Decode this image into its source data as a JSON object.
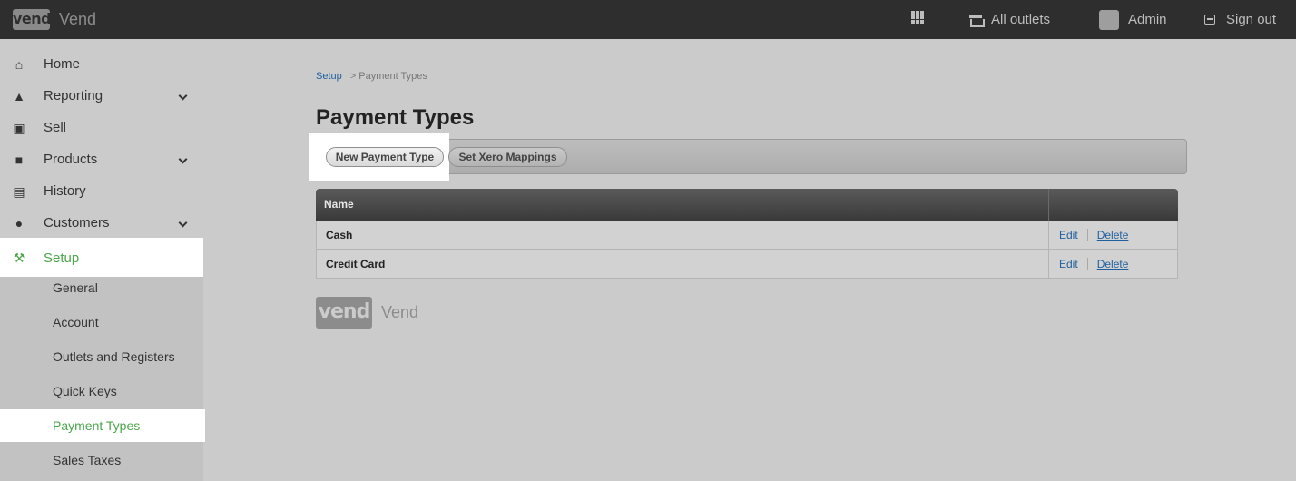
{
  "topbar": {
    "logo_mark": "vend",
    "app_name": "Vend",
    "outlets_label": "All outlets",
    "user_label": "Admin",
    "signout_label": "Sign out"
  },
  "sidebar": {
    "items": [
      {
        "label": "Home",
        "icon": "home-icon",
        "expandable": false
      },
      {
        "label": "Reporting",
        "icon": "chart-icon",
        "expandable": true
      },
      {
        "label": "Sell",
        "icon": "cart-icon",
        "expandable": false
      },
      {
        "label": "Products",
        "icon": "box-icon",
        "expandable": true
      },
      {
        "label": "History",
        "icon": "history-icon",
        "expandable": false
      },
      {
        "label": "Customers",
        "icon": "customers-icon",
        "expandable": true
      },
      {
        "label": "Setup",
        "icon": "wrench-icon",
        "expandable": false,
        "active": true
      }
    ],
    "setup_subitems": [
      {
        "label": "General"
      },
      {
        "label": "Account"
      },
      {
        "label": "Outlets and Registers"
      },
      {
        "label": "Quick Keys"
      },
      {
        "label": "Payment Types",
        "active": true
      },
      {
        "label": "Sales Taxes"
      }
    ]
  },
  "main": {
    "breadcrumb": {
      "link": "Setup",
      "current": "> Payment Types"
    },
    "title": "Payment Types",
    "toolbar": {
      "new_button": "New Payment Type",
      "xero_button": "Set Xero Mappings"
    },
    "table": {
      "columns": [
        "Name",
        ""
      ],
      "rows": [
        {
          "name": "Cash",
          "edit": "Edit",
          "delete": "Delete"
        },
        {
          "name": "Credit Card",
          "edit": "Edit",
          "delete": "Delete"
        }
      ]
    },
    "footer": {
      "logo_mark": "vend",
      "text": "Vend"
    }
  },
  "colors": {
    "topbar_bg": "#2e2e2e",
    "page_bg": "#cbcbcb",
    "active_green": "#4aa64a",
    "link_blue": "#1f5f9e"
  }
}
